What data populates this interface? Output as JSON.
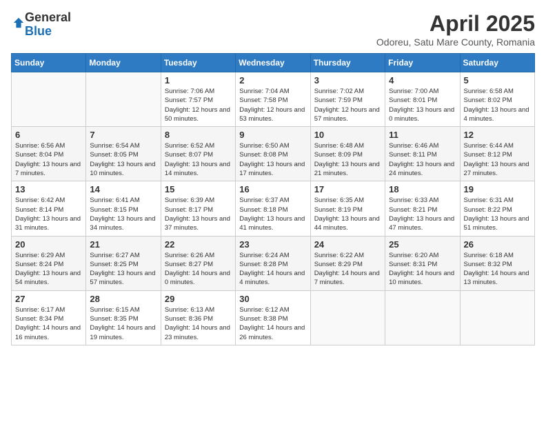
{
  "logo": {
    "general": "General",
    "blue": "Blue"
  },
  "title": "April 2025",
  "subtitle": "Odoreu, Satu Mare County, Romania",
  "weekdays": [
    "Sunday",
    "Monday",
    "Tuesday",
    "Wednesday",
    "Thursday",
    "Friday",
    "Saturday"
  ],
  "weeks": [
    [
      {
        "day": "",
        "info": ""
      },
      {
        "day": "",
        "info": ""
      },
      {
        "day": "1",
        "info": "Sunrise: 7:06 AM\nSunset: 7:57 PM\nDaylight: 12 hours and 50 minutes."
      },
      {
        "day": "2",
        "info": "Sunrise: 7:04 AM\nSunset: 7:58 PM\nDaylight: 12 hours and 53 minutes."
      },
      {
        "day": "3",
        "info": "Sunrise: 7:02 AM\nSunset: 7:59 PM\nDaylight: 12 hours and 57 minutes."
      },
      {
        "day": "4",
        "info": "Sunrise: 7:00 AM\nSunset: 8:01 PM\nDaylight: 13 hours and 0 minutes."
      },
      {
        "day": "5",
        "info": "Sunrise: 6:58 AM\nSunset: 8:02 PM\nDaylight: 13 hours and 4 minutes."
      }
    ],
    [
      {
        "day": "6",
        "info": "Sunrise: 6:56 AM\nSunset: 8:04 PM\nDaylight: 13 hours and 7 minutes."
      },
      {
        "day": "7",
        "info": "Sunrise: 6:54 AM\nSunset: 8:05 PM\nDaylight: 13 hours and 10 minutes."
      },
      {
        "day": "8",
        "info": "Sunrise: 6:52 AM\nSunset: 8:07 PM\nDaylight: 13 hours and 14 minutes."
      },
      {
        "day": "9",
        "info": "Sunrise: 6:50 AM\nSunset: 8:08 PM\nDaylight: 13 hours and 17 minutes."
      },
      {
        "day": "10",
        "info": "Sunrise: 6:48 AM\nSunset: 8:09 PM\nDaylight: 13 hours and 21 minutes."
      },
      {
        "day": "11",
        "info": "Sunrise: 6:46 AM\nSunset: 8:11 PM\nDaylight: 13 hours and 24 minutes."
      },
      {
        "day": "12",
        "info": "Sunrise: 6:44 AM\nSunset: 8:12 PM\nDaylight: 13 hours and 27 minutes."
      }
    ],
    [
      {
        "day": "13",
        "info": "Sunrise: 6:42 AM\nSunset: 8:14 PM\nDaylight: 13 hours and 31 minutes."
      },
      {
        "day": "14",
        "info": "Sunrise: 6:41 AM\nSunset: 8:15 PM\nDaylight: 13 hours and 34 minutes."
      },
      {
        "day": "15",
        "info": "Sunrise: 6:39 AM\nSunset: 8:17 PM\nDaylight: 13 hours and 37 minutes."
      },
      {
        "day": "16",
        "info": "Sunrise: 6:37 AM\nSunset: 8:18 PM\nDaylight: 13 hours and 41 minutes."
      },
      {
        "day": "17",
        "info": "Sunrise: 6:35 AM\nSunset: 8:19 PM\nDaylight: 13 hours and 44 minutes."
      },
      {
        "day": "18",
        "info": "Sunrise: 6:33 AM\nSunset: 8:21 PM\nDaylight: 13 hours and 47 minutes."
      },
      {
        "day": "19",
        "info": "Sunrise: 6:31 AM\nSunset: 8:22 PM\nDaylight: 13 hours and 51 minutes."
      }
    ],
    [
      {
        "day": "20",
        "info": "Sunrise: 6:29 AM\nSunset: 8:24 PM\nDaylight: 13 hours and 54 minutes."
      },
      {
        "day": "21",
        "info": "Sunrise: 6:27 AM\nSunset: 8:25 PM\nDaylight: 13 hours and 57 minutes."
      },
      {
        "day": "22",
        "info": "Sunrise: 6:26 AM\nSunset: 8:27 PM\nDaylight: 14 hours and 0 minutes."
      },
      {
        "day": "23",
        "info": "Sunrise: 6:24 AM\nSunset: 8:28 PM\nDaylight: 14 hours and 4 minutes."
      },
      {
        "day": "24",
        "info": "Sunrise: 6:22 AM\nSunset: 8:29 PM\nDaylight: 14 hours and 7 minutes."
      },
      {
        "day": "25",
        "info": "Sunrise: 6:20 AM\nSunset: 8:31 PM\nDaylight: 14 hours and 10 minutes."
      },
      {
        "day": "26",
        "info": "Sunrise: 6:18 AM\nSunset: 8:32 PM\nDaylight: 14 hours and 13 minutes."
      }
    ],
    [
      {
        "day": "27",
        "info": "Sunrise: 6:17 AM\nSunset: 8:34 PM\nDaylight: 14 hours and 16 minutes."
      },
      {
        "day": "28",
        "info": "Sunrise: 6:15 AM\nSunset: 8:35 PM\nDaylight: 14 hours and 19 minutes."
      },
      {
        "day": "29",
        "info": "Sunrise: 6:13 AM\nSunset: 8:36 PM\nDaylight: 14 hours and 23 minutes."
      },
      {
        "day": "30",
        "info": "Sunrise: 6:12 AM\nSunset: 8:38 PM\nDaylight: 14 hours and 26 minutes."
      },
      {
        "day": "",
        "info": ""
      },
      {
        "day": "",
        "info": ""
      },
      {
        "day": "",
        "info": ""
      }
    ]
  ]
}
